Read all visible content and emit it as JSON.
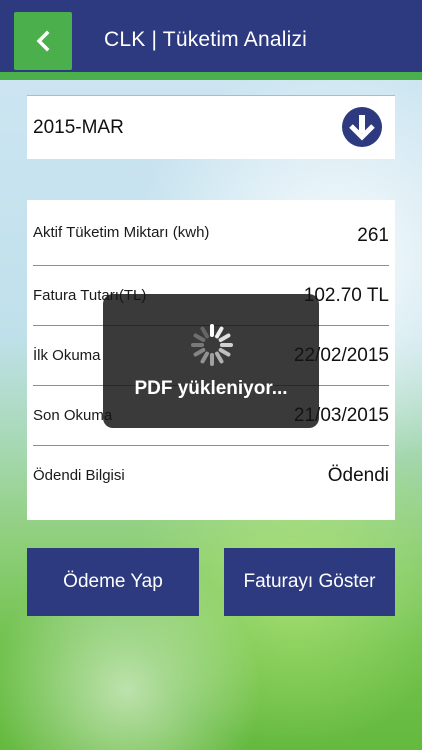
{
  "header": {
    "title": "CLK | Tüketim Analizi",
    "back_icon": "chevron-left-icon",
    "bar_color": "#2e3a7f",
    "accent_color": "#4bb04b"
  },
  "period_selector": {
    "value": "2015-MAR",
    "icon": "chevron-down-circle-icon"
  },
  "details": [
    {
      "label": "Aktif Tüketim Miktarı (kwh)",
      "value": "261"
    },
    {
      "label": "Fatura Tutarı(TL)",
      "value": "102.70 TL"
    },
    {
      "label": "İlk Okuma",
      "value": "22/02/2015"
    },
    {
      "label": "Son Okuma",
      "value": "21/03/2015"
    },
    {
      "label": "Ödendi Bilgisi",
      "value": "Ödendi"
    }
  ],
  "actions": {
    "pay_label": "Ödeme Yap",
    "show_invoice_label": "Faturayı Göster"
  },
  "loading_overlay": {
    "text": "PDF yükleniyor...",
    "icon": "spinner-icon"
  }
}
